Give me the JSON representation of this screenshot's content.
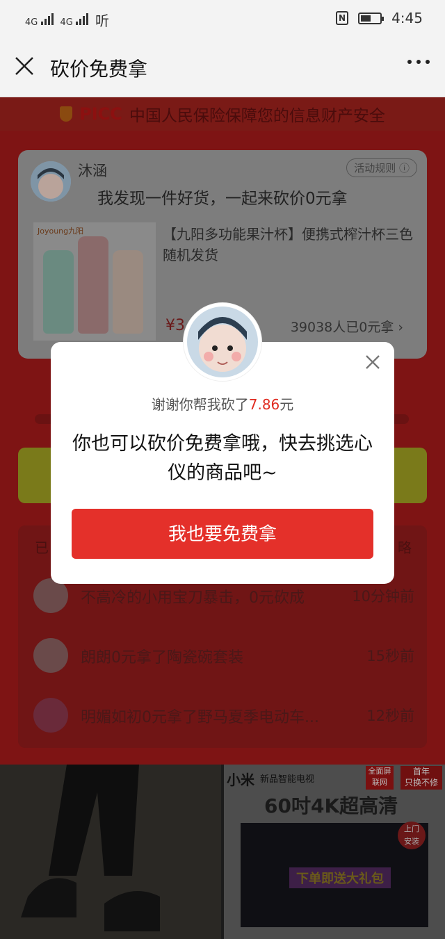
{
  "status_bar": {
    "net1": "4G",
    "net2": "4G",
    "app_glyph": "听",
    "time": "4:45",
    "icons": [
      "signal-icon",
      "nfc-icon",
      "battery-icon"
    ]
  },
  "nav": {
    "title": "砍价免费拿",
    "close_icon": "close-icon",
    "more_icon": "more-icon"
  },
  "page": {
    "banner": {
      "logo": "PICC",
      "text": "中国人民保险保障您的信息财产安全"
    },
    "card": {
      "user_name": "沐涵",
      "rules_label": "活动规则",
      "message": "我发现一件好货，一起来砍价0元拿",
      "product_brand": "Joyoung九阳",
      "product_title": "【九阳多功能果汁杯】便携式榨汁杯三色随机发货",
      "price_symbol": "¥3",
      "claimed_count": "39038人已0元拿"
    },
    "list": {
      "header": "已",
      "more": "略",
      "rows": [
        {
          "text": "不高冷的小用宝刀暴击，0元砍成",
          "time": "10分钟前"
        },
        {
          "text": "朗朗0元拿了陶瓷碗套装",
          "time": "15秒前"
        },
        {
          "text": "明媚如初0元拿了野马夏季电动车...",
          "time": "12秒前"
        }
      ]
    }
  },
  "ads": {
    "right": {
      "brand": "小米",
      "sub": "新品智能电视",
      "tag_a": "全面屏",
      "tag_a2": "联网",
      "tag_b": "首年",
      "tag_b2": "只换不修",
      "headline": "60吋4K超高清",
      "badge_a": "上门",
      "badge_b": "安装",
      "banner": "下单即送大礼包"
    }
  },
  "modal": {
    "thanks_prefix": "谢谢你帮我砍了",
    "amount": "7.86",
    "thanks_suffix": "元",
    "body": "你也可以砍价免费拿哦，快去挑选心仪的商品吧~",
    "button": "我也要免费拿",
    "accent_color": "#e4302a"
  }
}
